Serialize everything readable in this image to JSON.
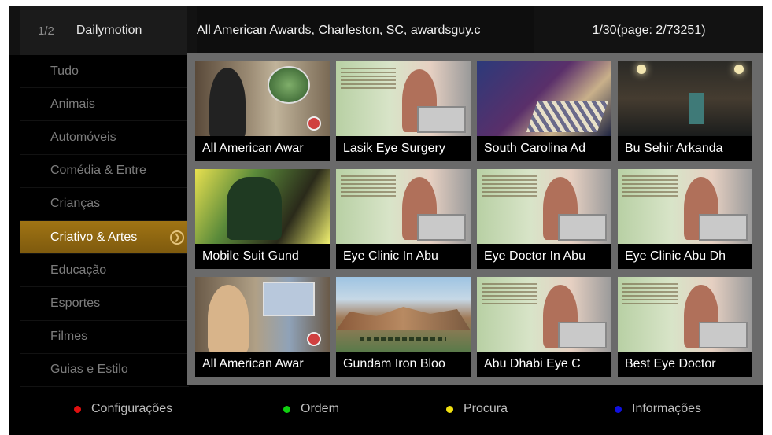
{
  "header": {
    "page_indicator": "1/2",
    "app_name": "Dailymotion",
    "selected_title": "All American Awards, Charleston, SC, awardsguy.c",
    "item_counter": "1/30(page: 2/73251)"
  },
  "sidebar": {
    "items": [
      {
        "label": "Tudo"
      },
      {
        "label": "Animais"
      },
      {
        "label": "Automóveis"
      },
      {
        "label": "Comédia & Entre"
      },
      {
        "label": "Crianças"
      },
      {
        "label": "Criativo & Artes"
      },
      {
        "label": "Educação"
      },
      {
        "label": "Esportes"
      },
      {
        "label": "Filmes"
      },
      {
        "label": "Guias e Estilo"
      }
    ],
    "active_index": 5,
    "active_color": "#a07414"
  },
  "videos": [
    {
      "title": "All American Awar",
      "thumb": "awards-store"
    },
    {
      "title": "Lasik Eye Surgery",
      "thumb": "woman-phone-laptop"
    },
    {
      "title": "South Carolina Ad",
      "thumb": "office-desk"
    },
    {
      "title": "Bu Sehir Arkanda",
      "thumb": "dark-street"
    },
    {
      "title": "Mobile Suit Gund",
      "thumb": "anime-robot"
    },
    {
      "title": "Eye Clinic In Abu",
      "thumb": "woman-phone-laptop"
    },
    {
      "title": "Eye Doctor In Abu",
      "thumb": "woman-phone-laptop"
    },
    {
      "title": "Eye Clinic Abu Dh",
      "thumb": "woman-phone-laptop"
    },
    {
      "title": "All American Awar",
      "thumb": "awards-store-woman"
    },
    {
      "title": "Gundam Iron Bloo",
      "thumb": "canyon"
    },
    {
      "title": "Abu Dhabi Eye C",
      "thumb": "woman-phone-laptop"
    },
    {
      "title": "Best Eye Doctor",
      "thumb": "woman-phone-laptop"
    }
  ],
  "footer": {
    "items": [
      {
        "label": "Configurações",
        "color": "#e01010"
      },
      {
        "label": "Ordem",
        "color": "#10d010"
      },
      {
        "label": "Procura",
        "color": "#f0e010"
      },
      {
        "label": "Informações",
        "color": "#1010e0"
      }
    ]
  }
}
